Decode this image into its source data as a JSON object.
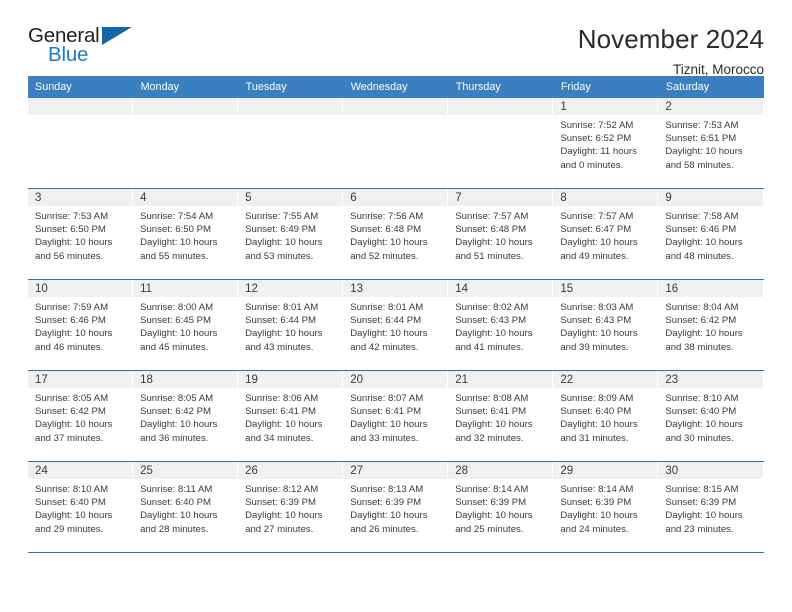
{
  "logo": {
    "word_one": "General",
    "word_two": "Blue",
    "triangle_icon": "triangle-icon"
  },
  "header": {
    "title": "November 2024",
    "subtitle": "Tiznit, Morocco",
    "accent_color": "#3a7fbf",
    "logo_blue": "#1d7cc4",
    "band_gray": "#f0f0f0"
  },
  "calendar": {
    "weekday_headers": [
      "Sunday",
      "Monday",
      "Tuesday",
      "Wednesday",
      "Thursday",
      "Friday",
      "Saturday"
    ],
    "weeks": [
      [
        {
          "day": "",
          "lines": []
        },
        {
          "day": "",
          "lines": []
        },
        {
          "day": "",
          "lines": []
        },
        {
          "day": "",
          "lines": []
        },
        {
          "day": "",
          "lines": []
        },
        {
          "day": "1",
          "lines": [
            "Sunrise: 7:52 AM",
            "Sunset: 6:52 PM",
            "Daylight: 11 hours",
            "and 0 minutes."
          ]
        },
        {
          "day": "2",
          "lines": [
            "Sunrise: 7:53 AM",
            "Sunset: 6:51 PM",
            "Daylight: 10 hours",
            "and 58 minutes."
          ]
        }
      ],
      [
        {
          "day": "3",
          "lines": [
            "Sunrise: 7:53 AM",
            "Sunset: 6:50 PM",
            "Daylight: 10 hours",
            "and 56 minutes."
          ]
        },
        {
          "day": "4",
          "lines": [
            "Sunrise: 7:54 AM",
            "Sunset: 6:50 PM",
            "Daylight: 10 hours",
            "and 55 minutes."
          ]
        },
        {
          "day": "5",
          "lines": [
            "Sunrise: 7:55 AM",
            "Sunset: 6:49 PM",
            "Daylight: 10 hours",
            "and 53 minutes."
          ]
        },
        {
          "day": "6",
          "lines": [
            "Sunrise: 7:56 AM",
            "Sunset: 6:48 PM",
            "Daylight: 10 hours",
            "and 52 minutes."
          ]
        },
        {
          "day": "7",
          "lines": [
            "Sunrise: 7:57 AM",
            "Sunset: 6:48 PM",
            "Daylight: 10 hours",
            "and 51 minutes."
          ]
        },
        {
          "day": "8",
          "lines": [
            "Sunrise: 7:57 AM",
            "Sunset: 6:47 PM",
            "Daylight: 10 hours",
            "and 49 minutes."
          ]
        },
        {
          "day": "9",
          "lines": [
            "Sunrise: 7:58 AM",
            "Sunset: 6:46 PM",
            "Daylight: 10 hours",
            "and 48 minutes."
          ]
        }
      ],
      [
        {
          "day": "10",
          "lines": [
            "Sunrise: 7:59 AM",
            "Sunset: 6:46 PM",
            "Daylight: 10 hours",
            "and 46 minutes."
          ]
        },
        {
          "day": "11",
          "lines": [
            "Sunrise: 8:00 AM",
            "Sunset: 6:45 PM",
            "Daylight: 10 hours",
            "and 45 minutes."
          ]
        },
        {
          "day": "12",
          "lines": [
            "Sunrise: 8:01 AM",
            "Sunset: 6:44 PM",
            "Daylight: 10 hours",
            "and 43 minutes."
          ]
        },
        {
          "day": "13",
          "lines": [
            "Sunrise: 8:01 AM",
            "Sunset: 6:44 PM",
            "Daylight: 10 hours",
            "and 42 minutes."
          ]
        },
        {
          "day": "14",
          "lines": [
            "Sunrise: 8:02 AM",
            "Sunset: 6:43 PM",
            "Daylight: 10 hours",
            "and 41 minutes."
          ]
        },
        {
          "day": "15",
          "lines": [
            "Sunrise: 8:03 AM",
            "Sunset: 6:43 PM",
            "Daylight: 10 hours",
            "and 39 minutes."
          ]
        },
        {
          "day": "16",
          "lines": [
            "Sunrise: 8:04 AM",
            "Sunset: 6:42 PM",
            "Daylight: 10 hours",
            "and 38 minutes."
          ]
        }
      ],
      [
        {
          "day": "17",
          "lines": [
            "Sunrise: 8:05 AM",
            "Sunset: 6:42 PM",
            "Daylight: 10 hours",
            "and 37 minutes."
          ]
        },
        {
          "day": "18",
          "lines": [
            "Sunrise: 8:05 AM",
            "Sunset: 6:42 PM",
            "Daylight: 10 hours",
            "and 36 minutes."
          ]
        },
        {
          "day": "19",
          "lines": [
            "Sunrise: 8:06 AM",
            "Sunset: 6:41 PM",
            "Daylight: 10 hours",
            "and 34 minutes."
          ]
        },
        {
          "day": "20",
          "lines": [
            "Sunrise: 8:07 AM",
            "Sunset: 6:41 PM",
            "Daylight: 10 hours",
            "and 33 minutes."
          ]
        },
        {
          "day": "21",
          "lines": [
            "Sunrise: 8:08 AM",
            "Sunset: 6:41 PM",
            "Daylight: 10 hours",
            "and 32 minutes."
          ]
        },
        {
          "day": "22",
          "lines": [
            "Sunrise: 8:09 AM",
            "Sunset: 6:40 PM",
            "Daylight: 10 hours",
            "and 31 minutes."
          ]
        },
        {
          "day": "23",
          "lines": [
            "Sunrise: 8:10 AM",
            "Sunset: 6:40 PM",
            "Daylight: 10 hours",
            "and 30 minutes."
          ]
        }
      ],
      [
        {
          "day": "24",
          "lines": [
            "Sunrise: 8:10 AM",
            "Sunset: 6:40 PM",
            "Daylight: 10 hours",
            "and 29 minutes."
          ]
        },
        {
          "day": "25",
          "lines": [
            "Sunrise: 8:11 AM",
            "Sunset: 6:40 PM",
            "Daylight: 10 hours",
            "and 28 minutes."
          ]
        },
        {
          "day": "26",
          "lines": [
            "Sunrise: 8:12 AM",
            "Sunset: 6:39 PM",
            "Daylight: 10 hours",
            "and 27 minutes."
          ]
        },
        {
          "day": "27",
          "lines": [
            "Sunrise: 8:13 AM",
            "Sunset: 6:39 PM",
            "Daylight: 10 hours",
            "and 26 minutes."
          ]
        },
        {
          "day": "28",
          "lines": [
            "Sunrise: 8:14 AM",
            "Sunset: 6:39 PM",
            "Daylight: 10 hours",
            "and 25 minutes."
          ]
        },
        {
          "day": "29",
          "lines": [
            "Sunrise: 8:14 AM",
            "Sunset: 6:39 PM",
            "Daylight: 10 hours",
            "and 24 minutes."
          ]
        },
        {
          "day": "30",
          "lines": [
            "Sunrise: 8:15 AM",
            "Sunset: 6:39 PM",
            "Daylight: 10 hours",
            "and 23 minutes."
          ]
        }
      ]
    ]
  }
}
